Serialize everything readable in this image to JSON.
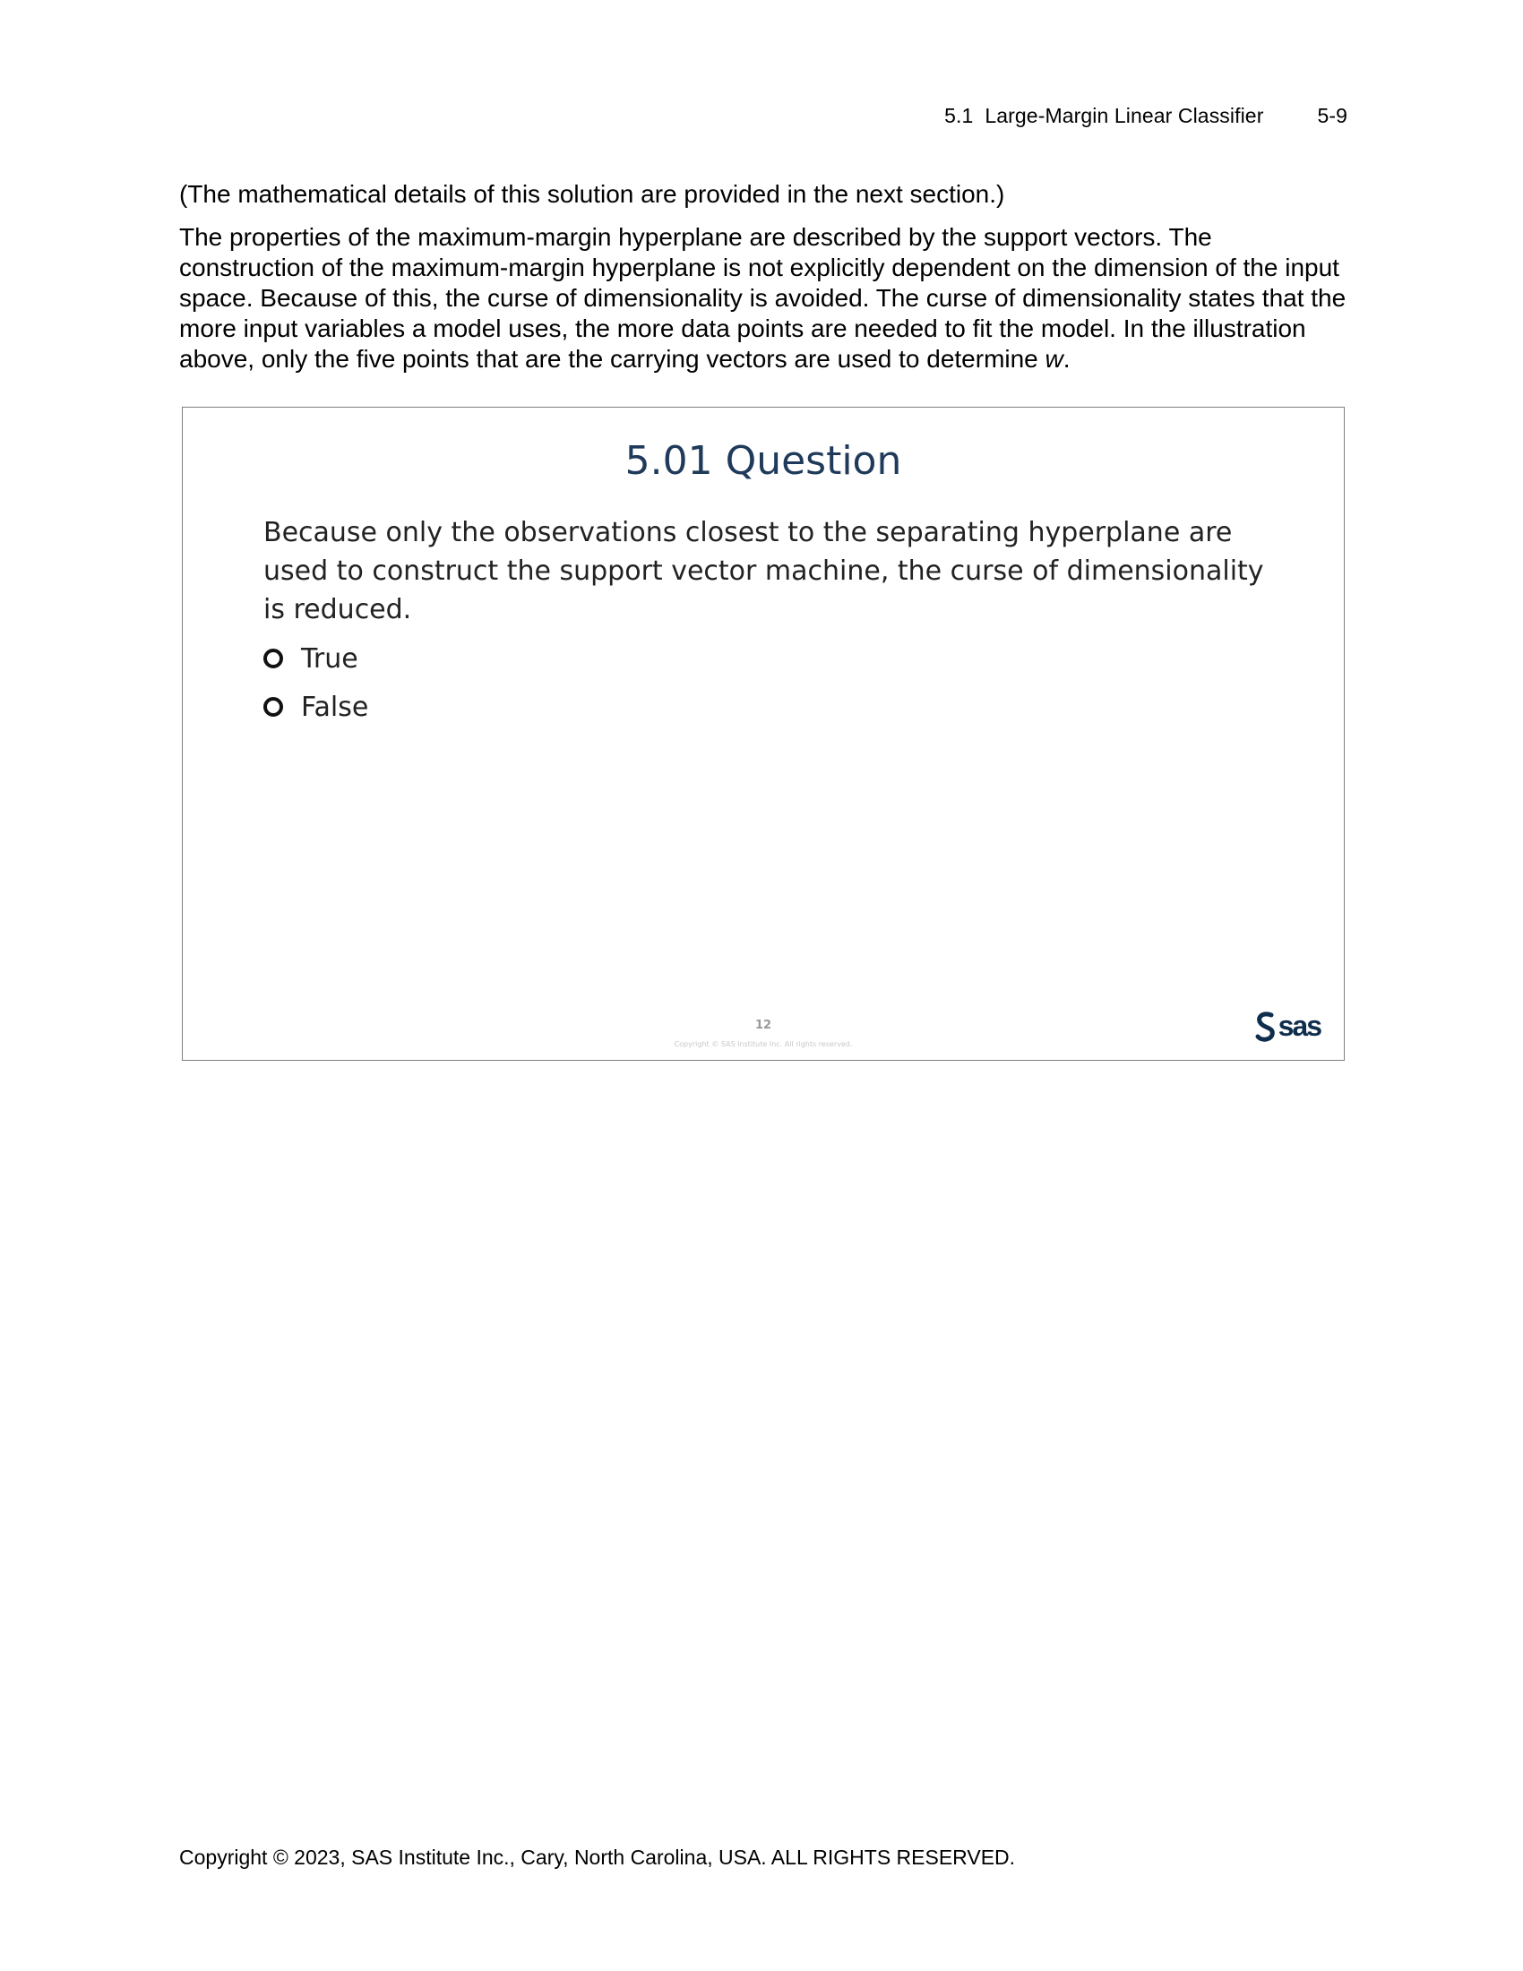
{
  "header": {
    "section": "5.1  Large-Margin Linear Classifier",
    "page": "5-9"
  },
  "body": {
    "paragraph1": "(The mathematical details of this solution are provided in the next section.)",
    "paragraph2_main": "The properties of the maximum-margin hyperplane are described by the support vectors. The construction of the maximum-margin hyperplane is not explicitly dependent on the dimension of the input space. Because of this, the curse of dimensionality is avoided. The curse of dimensionality states that the more input variables a model uses, the more data points are needed to fit the model. In the illustration above, only the five points that are the carrying vectors are used to determine ",
    "paragraph2_var": "w",
    "paragraph2_end": "."
  },
  "slide": {
    "title": "5.01 Question",
    "question": "Because only the observations closest to the separating hyperplane are used to construct the support vector machine, the curse of dimensionality is reduced.",
    "options": [
      "True",
      "False"
    ],
    "slide_number": "12",
    "slide_copyright": "Copyright © SAS Institute Inc. All rights reserved.",
    "logo_text": "sas",
    "brand_color": "#0f2d4d"
  },
  "footer": {
    "copyright": "Copyright © 2023, SAS Institute Inc., Cary, North Carolina, USA. ALL RIGHTS RESERVED."
  }
}
